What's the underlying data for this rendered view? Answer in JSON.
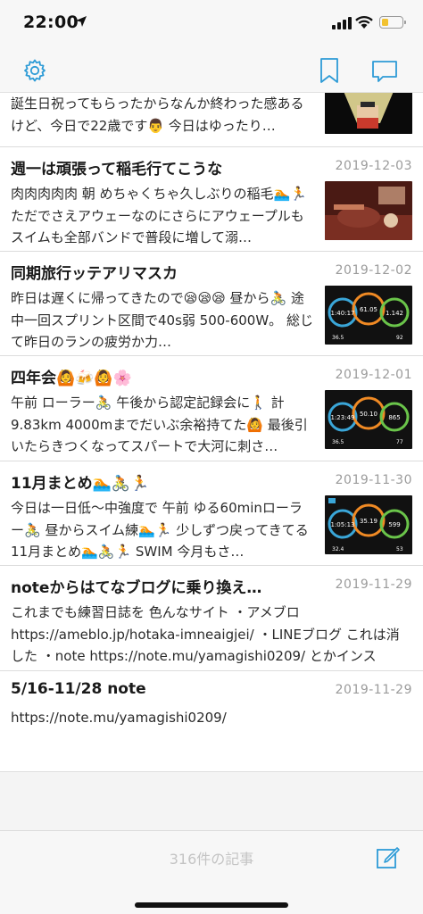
{
  "status": {
    "time": "22:00"
  },
  "colors": {
    "accent": "#2d9bd6",
    "date": "#9b9b9b",
    "battery": "#f2c230"
  },
  "nav": {
    "icons": [
      "gear-icon",
      "bookmark-icon",
      "comment-icon"
    ]
  },
  "entries": [
    {
      "title": "",
      "date": "",
      "body": "誕生日祝ってもらったからなんか終わった感あるけど、今日で22歳です👨 今日はゆったり…"
    },
    {
      "title": "週一は頑張って稲毛行てこうな",
      "date": "2019-12-03",
      "body": "肉肉肉肉肉 朝 めちゃくちゃ久しぶりの稲毛🏊🏃 ただでさえアウェーなのにさらにアウェープルもスイムも全部バンドで普段に増して溺…"
    },
    {
      "title": "同期旅行ッテアリマスカ",
      "date": "2019-12-02",
      "body": "昨日は遅くに帰ってきたので😪😪😪 昼から🚴 途中一回スプリント区間で40s弱 500-600W。 総じて昨日のランの疲労か力…",
      "watch": [
        "1:40:17",
        "61.05",
        "1.142",
        "36.5",
        "92"
      ]
    },
    {
      "title": "四年会🙆🍻🙆🌸",
      "date": "2019-12-01",
      "body": "午前 ローラー🚴 午後から認定記録会に🚶 計9.83km 4000mまでだいぶ余裕持てた🙆 最後引いたらきつくなってスパートで大河に刺さ…",
      "watch": [
        "1:23:49",
        "50.10",
        "865",
        "36.5",
        "77"
      ]
    },
    {
      "title": "11月まとめ🏊🚴🏃",
      "date": "2019-11-30",
      "body": "今日は一日低〜中強度で 午前 ゆる60minローラー🚴 昼からスイム練🏊🏃 少しずつ戻ってきてる 11月まとめ🏊🚴🏃 SWIM 今月もさ…",
      "watch": [
        "1:05:13",
        "35.19",
        "599",
        "32.4",
        "53"
      ]
    },
    {
      "title": "noteからはてなブログに乗り換え…",
      "date": "2019-11-29",
      "body": "これまでも練習日誌を 色んなサイト ・アメブロ https://ameblo.jp/hotaka-imneaigjei/ ・LINEブログ これは消した ・note https://note.mu/yamagishi0209/ とかインスタ、…"
    },
    {
      "title": "5/16-11/28 note",
      "date": "2019-11-29",
      "body": "https://note.mu/yamagishi0209/"
    }
  ],
  "footer": {
    "count_label": "316件の記事",
    "compose_icon": "compose-icon"
  }
}
